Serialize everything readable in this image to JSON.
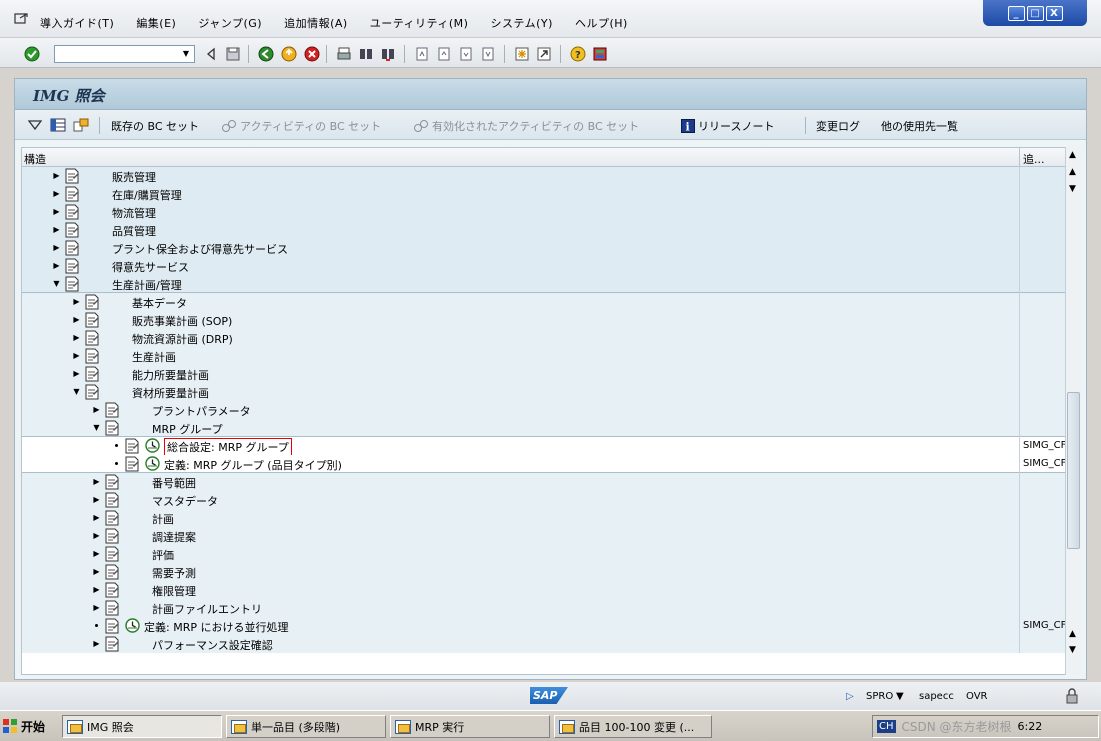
{
  "menubar": {
    "items": [
      "導入ガイド(T)",
      "編集(E)",
      "ジャンプ(G)",
      "追加情報(A)",
      "ユーティリティ(M)",
      "システム(Y)",
      "ヘルプ(H)"
    ]
  },
  "window_controls": {
    "minimize": "_",
    "maximize": "□",
    "close": "X"
  },
  "command_field": {
    "value": "",
    "placeholder": ""
  },
  "screen": {
    "title": "IMG 照会",
    "toolbar": {
      "existing_bc_sets": "既存の BC セット",
      "bc_sets_for_activity": "アクティビティの BC セット",
      "activated_bc_sets": "有効化されたアクティビティの BC セット",
      "release_notes": "リリースノート",
      "change_log": "変更ログ",
      "where_used": "他の使用先一覧"
    }
  },
  "tree": {
    "header": {
      "structure": "構造",
      "extra": "追..."
    },
    "rows": [
      {
        "label": "販売管理",
        "level": 0,
        "type": "collapsed",
        "band": "a",
        "extra": ""
      },
      {
        "label": "在庫/購買管理",
        "level": 0,
        "type": "collapsed",
        "band": "a",
        "extra": ""
      },
      {
        "label": "物流管理",
        "level": 0,
        "type": "collapsed",
        "band": "a",
        "extra": ""
      },
      {
        "label": "品質管理",
        "level": 0,
        "type": "collapsed",
        "band": "a",
        "extra": ""
      },
      {
        "label": "プラント保全および得意先サービス",
        "level": 0,
        "type": "collapsed",
        "band": "a",
        "extra": ""
      },
      {
        "label": "得意先サービス",
        "level": 0,
        "type": "collapsed",
        "band": "a",
        "extra": ""
      },
      {
        "label": "生産計画/管理",
        "level": 0,
        "type": "expanded",
        "band": "a",
        "extra": ""
      },
      {
        "label": "基本データ",
        "level": 1,
        "type": "collapsed",
        "band": "b",
        "extra": ""
      },
      {
        "label": "販売事業計画 (SOP)",
        "level": 1,
        "type": "collapsed",
        "band": "b",
        "extra": ""
      },
      {
        "label": "物流資源計画 (DRP)",
        "level": 1,
        "type": "collapsed",
        "band": "b",
        "extra": ""
      },
      {
        "label": "生産計画",
        "level": 1,
        "type": "collapsed",
        "band": "b",
        "extra": ""
      },
      {
        "label": "能力所要量計画",
        "level": 1,
        "type": "collapsed",
        "band": "b",
        "extra": ""
      },
      {
        "label": "資材所要量計画",
        "level": 1,
        "type": "expanded",
        "band": "b",
        "extra": ""
      },
      {
        "label": "プラントパラメータ",
        "level": 2,
        "type": "collapsed",
        "band": "b",
        "extra": ""
      },
      {
        "label": "MRP グループ",
        "level": 2,
        "type": "expanded",
        "band": "b",
        "extra": ""
      },
      {
        "label": "総合設定: MRP グループ",
        "level": 3,
        "type": "activity",
        "band": "c",
        "extra": "SIMG_CF",
        "boxed": true
      },
      {
        "label": "定義: MRP グループ (品目タイプ別)",
        "level": 3,
        "type": "activity",
        "band": "c",
        "extra": "SIMG_CF"
      },
      {
        "label": "番号範囲",
        "level": 2,
        "type": "collapsed",
        "band": "b",
        "extra": ""
      },
      {
        "label": "マスタデータ",
        "level": 2,
        "type": "collapsed",
        "band": "b",
        "extra": ""
      },
      {
        "label": "計画",
        "level": 2,
        "type": "collapsed",
        "band": "b",
        "extra": ""
      },
      {
        "label": "調達提案",
        "level": 2,
        "type": "collapsed",
        "band": "b",
        "extra": ""
      },
      {
        "label": "評価",
        "level": 2,
        "type": "collapsed",
        "band": "b",
        "extra": ""
      },
      {
        "label": "需要予測",
        "level": 2,
        "type": "collapsed",
        "band": "b",
        "extra": ""
      },
      {
        "label": "権限管理",
        "level": 2,
        "type": "collapsed",
        "band": "b",
        "extra": ""
      },
      {
        "label": "計画ファイルエントリ",
        "level": 2,
        "type": "collapsed",
        "band": "b",
        "extra": ""
      },
      {
        "label": "定義: MRP における並行処理",
        "level": 2,
        "type": "activity",
        "band": "b",
        "extra": "SIMG_CF"
      },
      {
        "label": "パフォーマンス設定確認",
        "level": 2,
        "type": "collapsed",
        "band": "b",
        "extra": ""
      }
    ]
  },
  "statusbar": {
    "logo": "SAP",
    "transaction": "SPRO",
    "server": "sapecc",
    "mode": "OVR"
  },
  "taskbar": {
    "start": "开始",
    "tasks": [
      "IMG 照会",
      "単一品目 (多段階)",
      "MRP 実行",
      "品目 100-100 変更 (..."
    ],
    "language": "CH",
    "watermark": "CSDN @东方老树根",
    "clock": "6:22"
  }
}
